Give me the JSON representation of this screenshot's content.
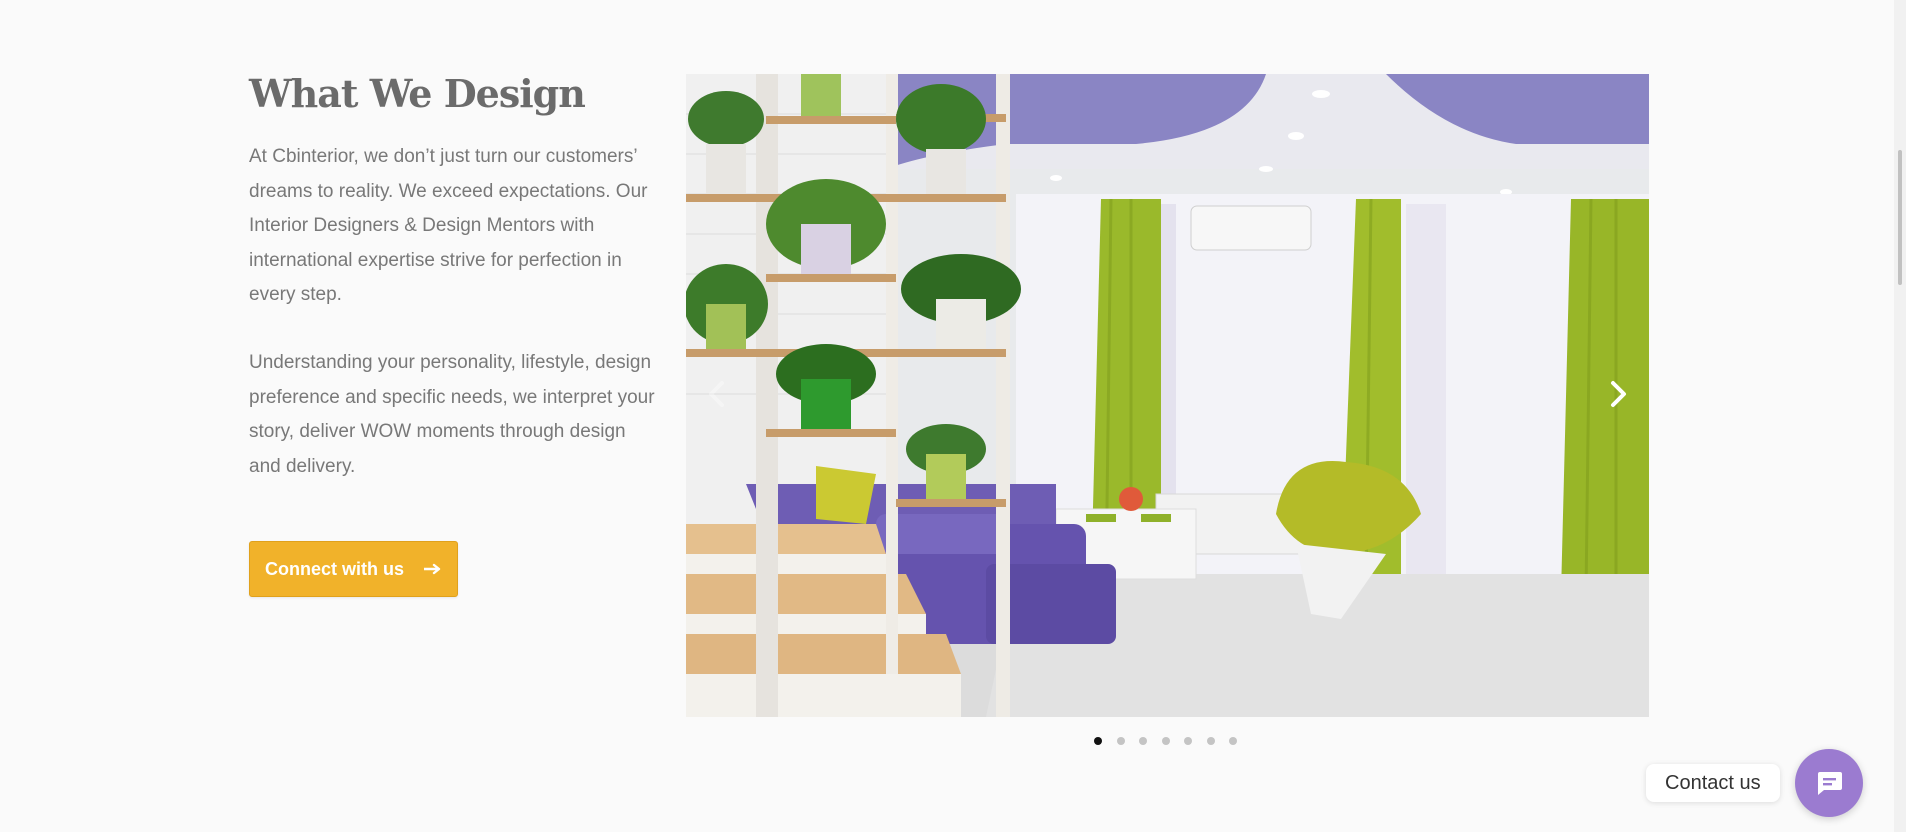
{
  "section": {
    "title": "What We Design",
    "paragraphs": [
      "At Cbinterior, we don’t just turn our customers’ dreams to reality. We exceed expectations. Our Interior Designers & Design Mentors with international expertise strive for perfection in every step.",
      "Understanding your personality, lifestyle, design preference and specific needs, we interpret your story, deliver WOW moments through design and delivery."
    ],
    "cta_label": "Connect with us",
    "cta_icon": "arrow-right-icon"
  },
  "slider": {
    "image_icon": "living-room-photo",
    "prev_icon": "chevron-left-icon",
    "next_icon": "chevron-right-icon",
    "slide_count": 7,
    "active_slide": 1
  },
  "contact": {
    "label": "Contact us",
    "icon": "chat-bubble-icon",
    "color": "#9b7bd0"
  },
  "colors": {
    "accent": "#f1b22a",
    "heading": "#6b6b6b",
    "body_text": "#787878"
  }
}
